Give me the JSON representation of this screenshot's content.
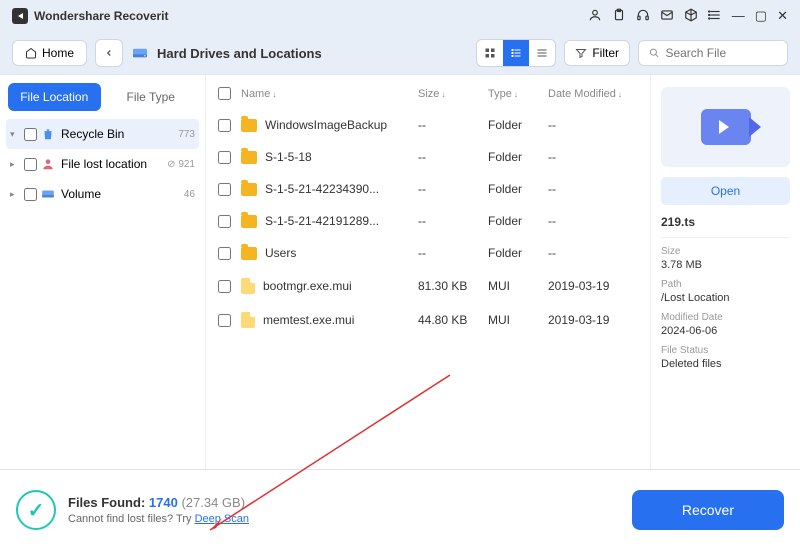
{
  "app": {
    "title": "Wondershare Recoverit"
  },
  "toolbar": {
    "home": "Home",
    "breadcrumb": "Hard Drives and Locations",
    "filter": "Filter",
    "search_placeholder": "Search File"
  },
  "sidebar": {
    "tabs": {
      "location": "File Location",
      "type": "File Type"
    },
    "items": [
      {
        "icon": "trash",
        "label": "Recycle Bin",
        "count": "773",
        "selected": true
      },
      {
        "icon": "user",
        "label": "File lost location",
        "count": "⊘ 921"
      },
      {
        "icon": "disk",
        "label": "Volume",
        "count": "46"
      }
    ]
  },
  "table": {
    "headers": {
      "name": "Name",
      "size": "Size",
      "type": "Type",
      "date": "Date Modified"
    },
    "rows": [
      {
        "kind": "folder",
        "name": "WindowsImageBackup",
        "size": "--",
        "type": "Folder",
        "date": "--"
      },
      {
        "kind": "folder",
        "name": "S-1-5-18",
        "size": "--",
        "type": "Folder",
        "date": "--"
      },
      {
        "kind": "folder",
        "name": "S-1-5-21-42234390...",
        "size": "--",
        "type": "Folder",
        "date": "--"
      },
      {
        "kind": "folder",
        "name": "S-1-5-21-42191289...",
        "size": "--",
        "type": "Folder",
        "date": "--"
      },
      {
        "kind": "folder",
        "name": "Users",
        "size": "--",
        "type": "Folder",
        "date": "--"
      },
      {
        "kind": "file",
        "name": "bootmgr.exe.mui",
        "size": "81.30 KB",
        "type": "MUI",
        "date": "2019-03-19"
      },
      {
        "kind": "file",
        "name": "memtest.exe.mui",
        "size": "44.80 KB",
        "type": "MUI",
        "date": "2019-03-19"
      }
    ]
  },
  "preview": {
    "open": "Open",
    "filename": "219.ts",
    "size_label": "Size",
    "size": "3.78 MB",
    "path_label": "Path",
    "path": "/Lost Location",
    "date_label": "Modified Date",
    "date": "2024-06-06",
    "status_label": "File Status",
    "status": "Deleted files"
  },
  "footer": {
    "found_label": "Files Found:",
    "found_count": "1740",
    "found_size": "(27.34 GB)",
    "hint_pre": "Cannot find lost files? Try ",
    "hint_link": "Deep Scan",
    "recover": "Recover"
  }
}
